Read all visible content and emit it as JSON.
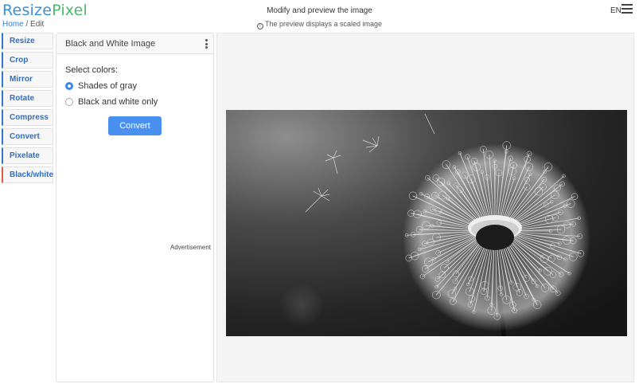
{
  "header": {
    "logo_part1": "Resize",
    "logo_part2": "Pixel",
    "breadcrumb_home": "Home",
    "breadcrumb_sep": " / ",
    "breadcrumb_current": "Edit",
    "title": "Modify and preview the image",
    "subtitle": "The preview displays a scaled image",
    "language": "EN",
    "info_icon": "info-icon",
    "menu_icon": "hamburger-menu-icon"
  },
  "sidebar": {
    "items": [
      {
        "label": "Resize"
      },
      {
        "label": "Crop"
      },
      {
        "label": "Mirror"
      },
      {
        "label": "Rotate"
      },
      {
        "label": "Compress"
      },
      {
        "label": "Convert"
      },
      {
        "label": "Pixelate"
      },
      {
        "label": "Black/white",
        "active": true
      }
    ]
  },
  "panel": {
    "title": "Black and White Image",
    "menu_icon": "vertical-dots-icon",
    "select_label": "Select colors:",
    "options": [
      {
        "label": "Shades of gray",
        "checked": true
      },
      {
        "label": "Black and white only",
        "checked": false
      }
    ],
    "convert_label": "Convert",
    "advertisement": "Advertisement"
  },
  "preview": {
    "image_subject": "grayscale-dandelion-photo"
  },
  "colors": {
    "accent": "#2e7bd6",
    "button": "#4a90f0",
    "active_marker": "#e05a4a",
    "logo_green": "#4db86a"
  }
}
